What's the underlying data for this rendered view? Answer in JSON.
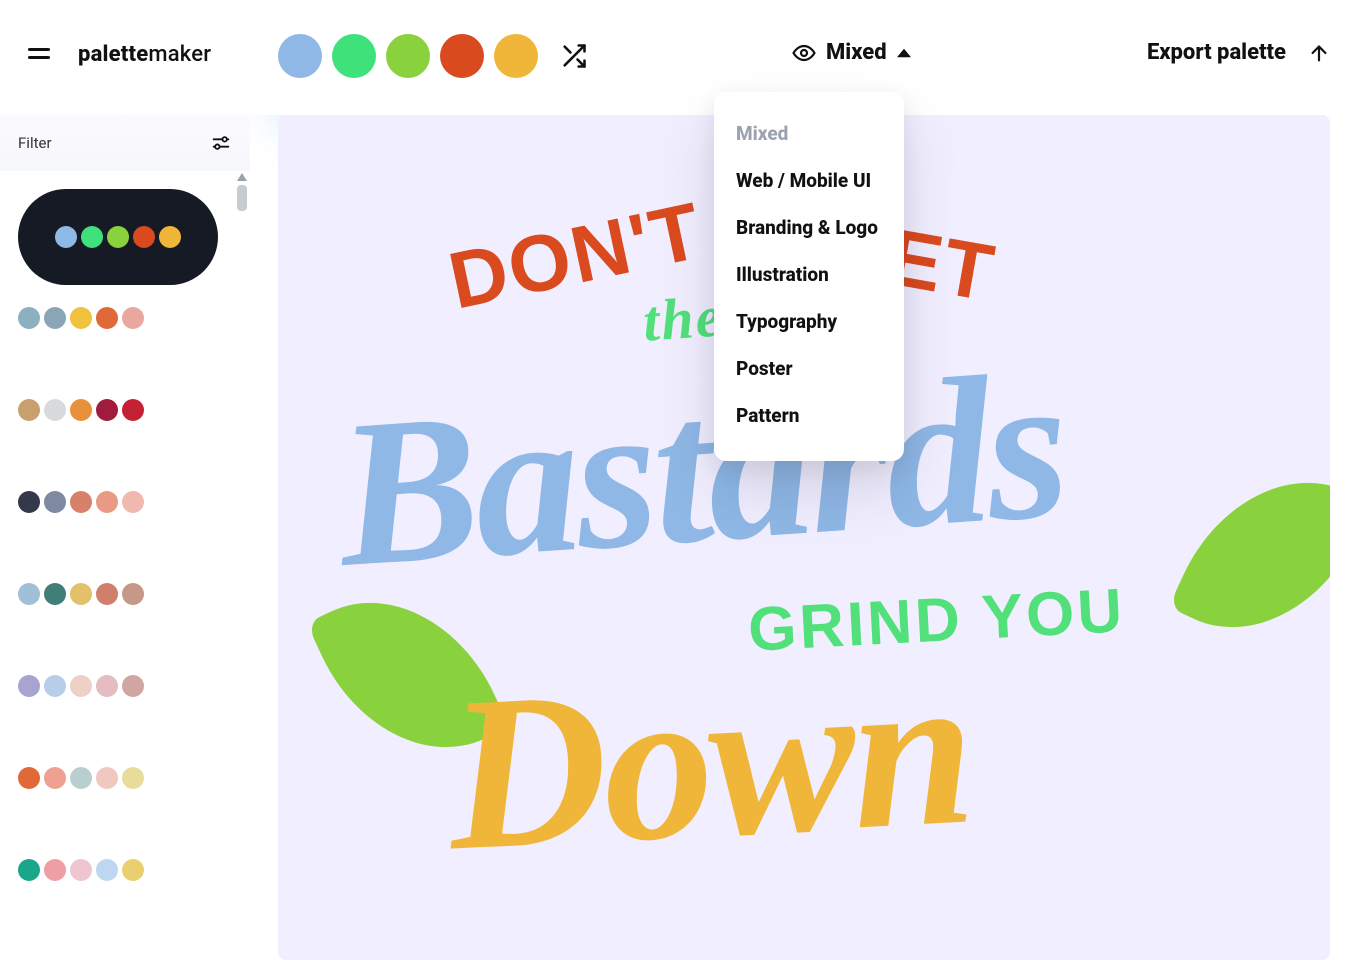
{
  "header": {
    "logo_prefix": "palette",
    "logo_suffix": "maker",
    "preview_label": "Mixed",
    "export_label": "Export palette"
  },
  "top_palette": [
    "#8fb8e6",
    "#3fe27a",
    "#8ad23d",
    "#da4a1f",
    "#f0b63a"
  ],
  "dropdown": {
    "items": [
      "Mixed",
      "Web / Mobile UI",
      "Branding & Logo",
      "Illustration",
      "Typography",
      "Poster",
      "Pattern"
    ],
    "selected_index": 0
  },
  "sidebar": {
    "filter_label": "Filter",
    "palettes": [
      {
        "selected": true,
        "colors": [
          "#8fb8e6",
          "#3fe27a",
          "#8ad23d",
          "#da4a1f",
          "#f0b63a"
        ]
      },
      {
        "selected": false,
        "colors": [
          "#8bb0c0",
          "#8aa6b6",
          "#f0c23d",
          "#e0693a",
          "#eaa7a0"
        ]
      },
      {
        "selected": false,
        "colors": [
          "#c8a06f",
          "#d7dbdd",
          "#e9903a",
          "#a01c3f",
          "#c62035"
        ]
      },
      {
        "selected": false,
        "colors": [
          "#33394a",
          "#7f8aa0",
          "#d7816b",
          "#e99a84",
          "#efb9ad"
        ]
      },
      {
        "selected": false,
        "colors": [
          "#9fc0d6",
          "#3f7f78",
          "#e3c06a",
          "#cf7f6a",
          "#c59887"
        ]
      },
      {
        "selected": false,
        "colors": [
          "#a7a5cf",
          "#b7cdea",
          "#efd0c6",
          "#e4bcc1",
          "#cfa6a1"
        ]
      },
      {
        "selected": false,
        "colors": [
          "#e0693a",
          "#efa191",
          "#b9cfcf",
          "#efc8bf",
          "#e8dc9a"
        ]
      },
      {
        "selected": false,
        "colors": [
          "#1aa68a",
          "#ef9fa3",
          "#efc6cf",
          "#bcd7ef",
          "#e9cf6f"
        ]
      }
    ]
  },
  "artwork": {
    "line1a": "DON'T",
    "line1b": "LET",
    "line_the": "the",
    "line2": "Bastards",
    "line_ds": "",
    "line3": "GRIND YOU",
    "line4": "Down"
  }
}
